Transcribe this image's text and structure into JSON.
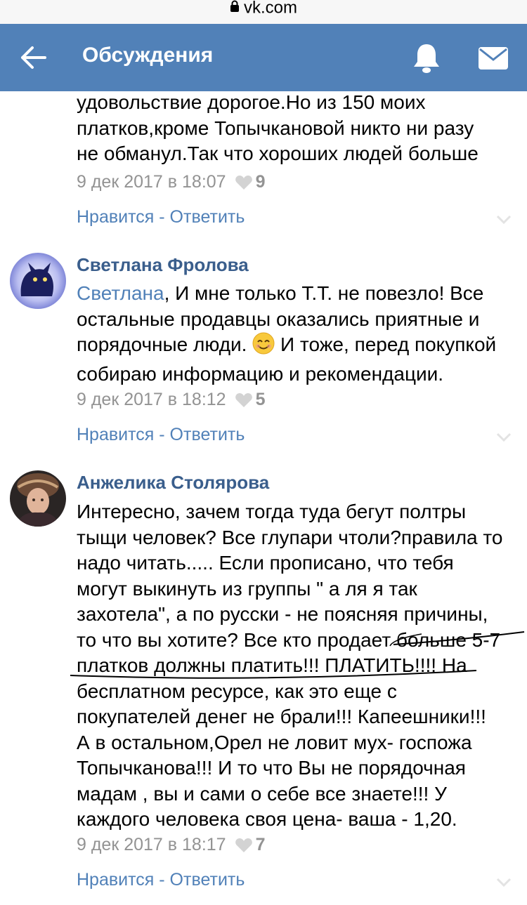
{
  "browser": {
    "domain": "vk.com"
  },
  "header": {
    "title": "Обсуждения"
  },
  "comments": [
    {
      "text": "удовольствие дорогое.Но из 150 моих\nплатков,кроме Топычкановой никто ни разу\nне обманул.Так что хороших людей больше",
      "date": "9 дек 2017 в 18:07",
      "likes": "9",
      "like_label": "Нравится",
      "sep": " - ",
      "reply_label": "Ответить"
    },
    {
      "author": "Светлана Фролова",
      "reply_to": "Светлана",
      "text_part1": ", И мне только Т.Т. не повезло! Все\nостальные продавцы оказались приятные и\nпорядочные люди. ",
      "text_part2": " И тоже, перед покупкой\nсобираю информацию и рекомендации.",
      "date": "9 дек 2017 в 18:12",
      "likes": "5",
      "like_label": "Нравится",
      "sep": " - ",
      "reply_label": "Ответить"
    },
    {
      "author": "Анжелика Столярова",
      "text": "Интересно, зачем тогда туда бегут полтры\nтыщи человек? Все глупари чтоли?правила то\nнадо читать..... Если прописано, что тебя\nмогут выкинуть из группы \" а ля я так\nзахотела\", а по русски - не поясняя причины,\nто что вы хотите? Все кто продает больше 5-7\nплатков должны платить!!! ПЛАТИТЬ!!!! На\nбесплатном ресурсе, как это еще с\nпокупателей денег не брали!!! Капеешники!!!\nА в остальном,Орел не ловит мух- госпожа\nТопычканова!!! И то что Вы не порядочная\nмадам , вы и сами о себе все знаете!!! У\nкаждого человека своя цена- ваша - 1,20.",
      "date": "9 дек 2017 в 18:17",
      "likes": "7",
      "like_label": "Нравится",
      "sep": " - ",
      "reply_label": "Ответить"
    }
  ],
  "colors": {
    "header_bg": "#5181b8",
    "link": "#5181b8",
    "author": "#3a5e8c",
    "meta": "#939393"
  },
  "icons": [
    "lock-icon",
    "back-arrow-icon",
    "bell-icon",
    "mail-icon",
    "heart-icon",
    "chevron-down-icon",
    "smile-emoji-icon"
  ]
}
